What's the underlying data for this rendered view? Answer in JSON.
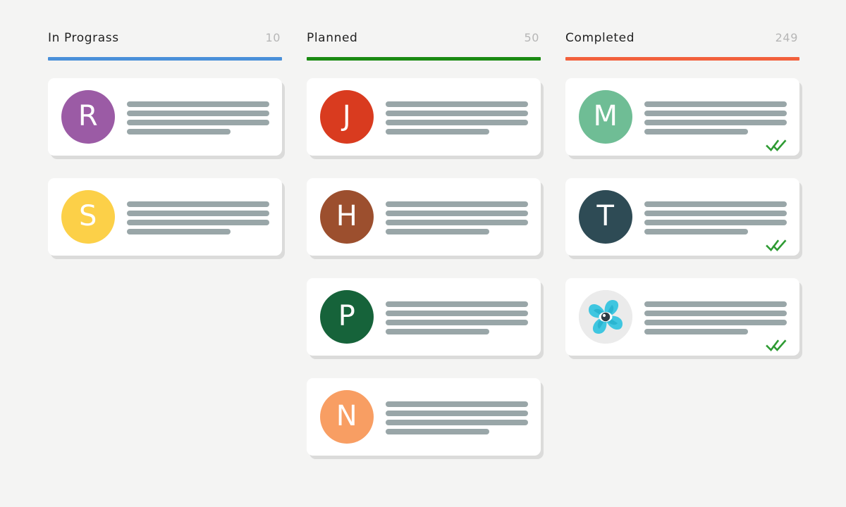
{
  "board": {
    "background_color": "#f4f4f3",
    "columns": [
      {
        "id": "in-progress",
        "title": "In Prograss",
        "count": "10",
        "accent_color": "#4a90d9",
        "cards": [
          {
            "id": "card-r",
            "avatar_type": "letter",
            "initial": "R",
            "avatar_color": "#9b5ba5",
            "lines": [
              100,
              100,
              100,
              73
            ],
            "checked": false
          },
          {
            "id": "card-s",
            "avatar_type": "letter",
            "initial": "S",
            "avatar_color": "#fcd048",
            "lines": [
              100,
              100,
              100,
              73
            ],
            "checked": false
          }
        ]
      },
      {
        "id": "planned",
        "title": "Planned",
        "count": "50",
        "accent_color": "#1a8a12",
        "cards": [
          {
            "id": "card-j",
            "avatar_type": "letter",
            "initial": "J",
            "avatar_color": "#d93b1f",
            "lines": [
              100,
              100,
              100,
              73
            ],
            "checked": false
          },
          {
            "id": "card-h",
            "avatar_type": "letter",
            "initial": "H",
            "avatar_color": "#9c4f2e",
            "lines": [
              100,
              100,
              100,
              73
            ],
            "checked": false
          },
          {
            "id": "card-p",
            "avatar_type": "letter",
            "initial": "P",
            "avatar_color": "#16633a",
            "lines": [
              100,
              100,
              100,
              73
            ],
            "checked": false
          },
          {
            "id": "card-n",
            "avatar_type": "letter",
            "initial": "N",
            "avatar_color": "#f89e63",
            "lines": [
              100,
              100,
              100,
              73
            ],
            "checked": false
          }
        ]
      },
      {
        "id": "completed",
        "title": "Completed",
        "count": "249",
        "accent_color": "#f2603c",
        "cards": [
          {
            "id": "card-m",
            "avatar_type": "letter",
            "initial": "M",
            "avatar_color": "#6fbd95",
            "lines": [
              100,
              100,
              100,
              73
            ],
            "checked": true
          },
          {
            "id": "card-t",
            "avatar_type": "letter",
            "initial": "T",
            "avatar_color": "#2e4b55",
            "lines": [
              100,
              100,
              100,
              73
            ],
            "checked": true
          },
          {
            "id": "card-logo",
            "avatar_type": "logo",
            "initial": "",
            "avatar_color": "#ebebeb",
            "logo_name": "shutter-eye-logo",
            "logo_colors": {
              "blade_light": "#3fc6e0",
              "blade_dark": "#1aa8c6",
              "eye": "#2d3b44",
              "background": "#ebebeb"
            },
            "lines": [
              100,
              100,
              100,
              73
            ],
            "checked": true
          }
        ]
      }
    ],
    "icons": {
      "double-check": "✓✓",
      "double_check_color": "#2e9b33"
    }
  }
}
